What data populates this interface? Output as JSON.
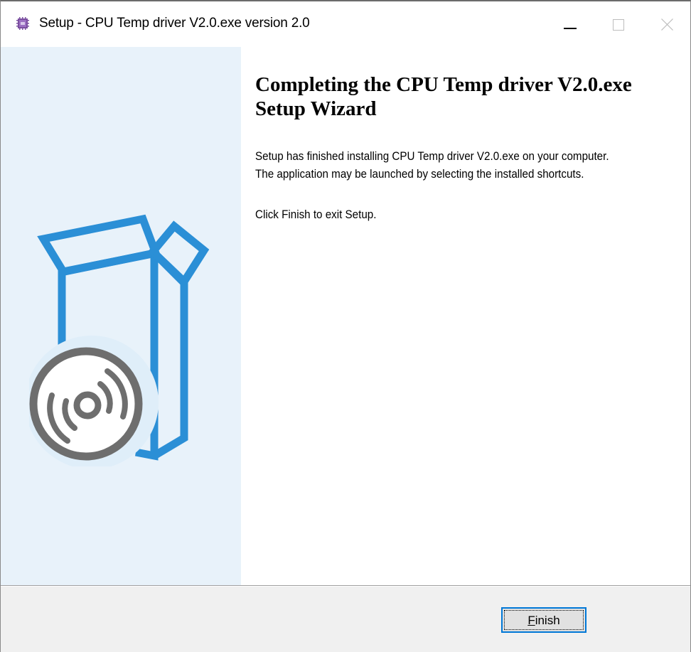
{
  "window": {
    "title": "Setup - CPU Temp driver V2.0.exe version 2.0",
    "icon": "app-chip-icon",
    "controls": {
      "minimize": "minimize-icon",
      "maximize": "maximize-icon",
      "close": "close-icon"
    }
  },
  "wizard": {
    "heading": "Completing the CPU Temp driver V2.0.exe Setup Wizard",
    "line_1": "Setup has finished installing CPU Temp driver V2.0.exe on your computer.",
    "line_2": "The application may be launched by selecting the installed shortcuts.",
    "line_3": "Click Finish to exit Setup.",
    "side_graphic": "install-box-disc-icon"
  },
  "footer": {
    "finish_mnemonic": "F",
    "finish_rest": "inish"
  },
  "colors": {
    "side_panel": "#e8f2fa",
    "accent_blue": "#2b8fd6",
    "disc_gray": "#6e6e6e",
    "focus_border": "#0078d7"
  }
}
